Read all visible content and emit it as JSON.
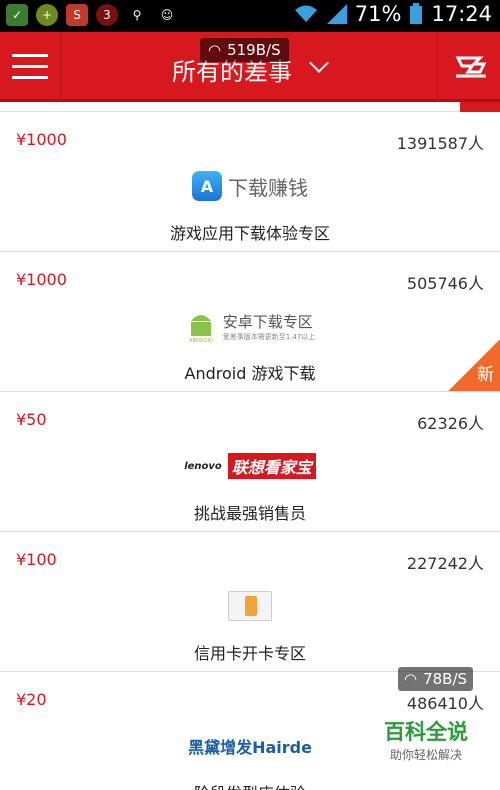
{
  "status_bar": {
    "battery": "71%",
    "time": "17:24"
  },
  "topbar": {
    "title": "所有的差事",
    "network_speed": "519B/S"
  },
  "tasks": [
    {
      "price": "¥1000",
      "count": "1391587人",
      "logo_text": "下载赚钱",
      "label": "游戏应用下载体验专区",
      "logo_type": "app-store"
    },
    {
      "price": "¥1000",
      "count": "505746人",
      "logo_text": "安卓下载专区",
      "logo_subtext": "爱差事版本需更新至1.47以上",
      "label": "Android 游戏下载",
      "logo_type": "android",
      "badge": "新"
    },
    {
      "price": "¥50",
      "count": "62326人",
      "logo_text": "联想看家宝",
      "logo_brand": "lenovo",
      "label": "挑战最强销售员",
      "logo_type": "lenovo"
    },
    {
      "price": "¥100",
      "count": "227242人",
      "label": "信用卡开卡专区",
      "logo_type": "credit-card"
    },
    {
      "price": "¥20",
      "count": "486410人",
      "logo_text": "黑黛增发Hairde",
      "label": "阶段发型店体验",
      "logo_type": "hairde"
    }
  ],
  "overlay": {
    "network_speed": "78B/S",
    "watermark_title": "百科全说",
    "watermark_subtitle": "助你轻松解决"
  },
  "colors": {
    "brand_red": "#d7191f",
    "badge_orange": "#f26a29"
  }
}
